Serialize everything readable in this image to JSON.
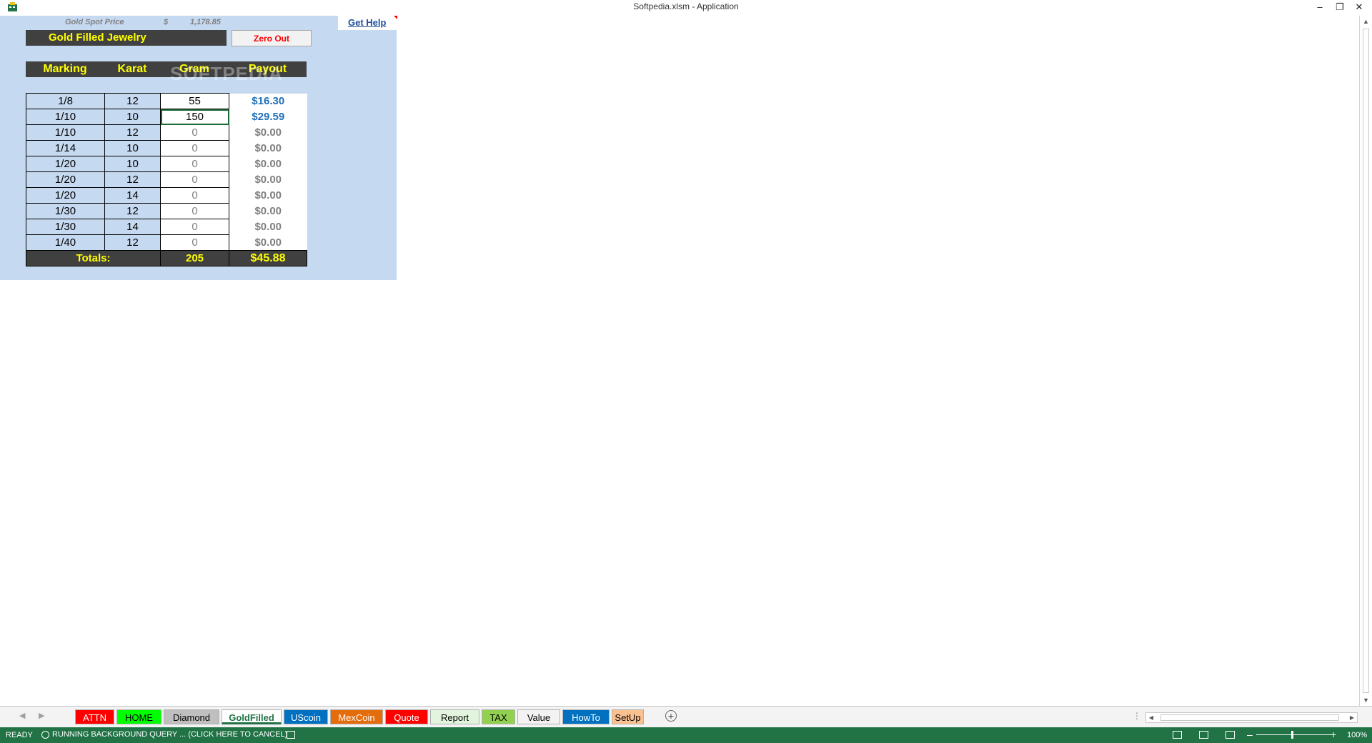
{
  "window": {
    "title": "Softpedia.xlsm - Application"
  },
  "sheet": {
    "spot_label": "Gold Spot Price",
    "spot_currency": "$",
    "spot_value": "1,178.85",
    "title": "Gold Filled Jewelry",
    "zero_out_label": "Zero Out",
    "get_help_label": "Get Help",
    "watermark": "SOFTPEDIA",
    "headers": [
      "Marking",
      "Karat",
      "Gram",
      "Payout"
    ],
    "rows": [
      {
        "marking": "1/8",
        "karat": "12",
        "gram": "55",
        "payout": "$16.30"
      },
      {
        "marking": "1/10",
        "karat": "10",
        "gram": "150",
        "payout": "$29.59"
      },
      {
        "marking": "1/10",
        "karat": "12",
        "gram": "0",
        "payout": "$0.00"
      },
      {
        "marking": "1/14",
        "karat": "10",
        "gram": "0",
        "payout": "$0.00"
      },
      {
        "marking": "1/20",
        "karat": "10",
        "gram": "0",
        "payout": "$0.00"
      },
      {
        "marking": "1/20",
        "karat": "12",
        "gram": "0",
        "payout": "$0.00"
      },
      {
        "marking": "1/20",
        "karat": "14",
        "gram": "0",
        "payout": "$0.00"
      },
      {
        "marking": "1/30",
        "karat": "12",
        "gram": "0",
        "payout": "$0.00"
      },
      {
        "marking": "1/30",
        "karat": "14",
        "gram": "0",
        "payout": "$0.00"
      },
      {
        "marking": "1/40",
        "karat": "12",
        "gram": "0",
        "payout": "$0.00"
      }
    ],
    "totals": {
      "label": "Totals:",
      "gram": "205",
      "payout": "$45.88"
    }
  },
  "tabs": [
    {
      "label": "ATTN",
      "bg": "#ff0000",
      "fg": "#ffffff",
      "active": false
    },
    {
      "label": "HOME",
      "bg": "#00ff00",
      "fg": "#000000",
      "active": false
    },
    {
      "label": "Diamond",
      "bg": "#bfbfbf",
      "fg": "#000000",
      "active": false
    },
    {
      "label": "GoldFilled",
      "bg": "#ffffff",
      "fg": "#217346",
      "active": true
    },
    {
      "label": "UScoin",
      "bg": "#0070c0",
      "fg": "#ffffff",
      "active": false
    },
    {
      "label": "MexCoin",
      "bg": "#e46c0a",
      "fg": "#ffffff",
      "active": false
    },
    {
      "label": "Quote",
      "bg": "#ff0000",
      "fg": "#ffffff",
      "active": false
    },
    {
      "label": "Report",
      "bg": "#e2f3de",
      "fg": "#000000",
      "active": false
    },
    {
      "label": "TAX",
      "bg": "#92d050",
      "fg": "#000000",
      "active": false
    },
    {
      "label": "Value",
      "bg": "#f3f3f3",
      "fg": "#000000",
      "active": false
    },
    {
      "label": "HowTo",
      "bg": "#0070c0",
      "fg": "#ffffff",
      "active": false
    },
    {
      "label": "SetUp",
      "bg": "#fac090",
      "fg": "#000000",
      "active": false
    }
  ],
  "status": {
    "ready": "READY",
    "query": "RUNNING BACKGROUND QUERY ...   (CLICK HERE TO CANCEL)",
    "zoom": "100%"
  },
  "colors": {
    "accent": "#217346",
    "header_bg": "#404040",
    "header_fg": "#ffff00",
    "panel_bg": "#c5d9f1"
  }
}
